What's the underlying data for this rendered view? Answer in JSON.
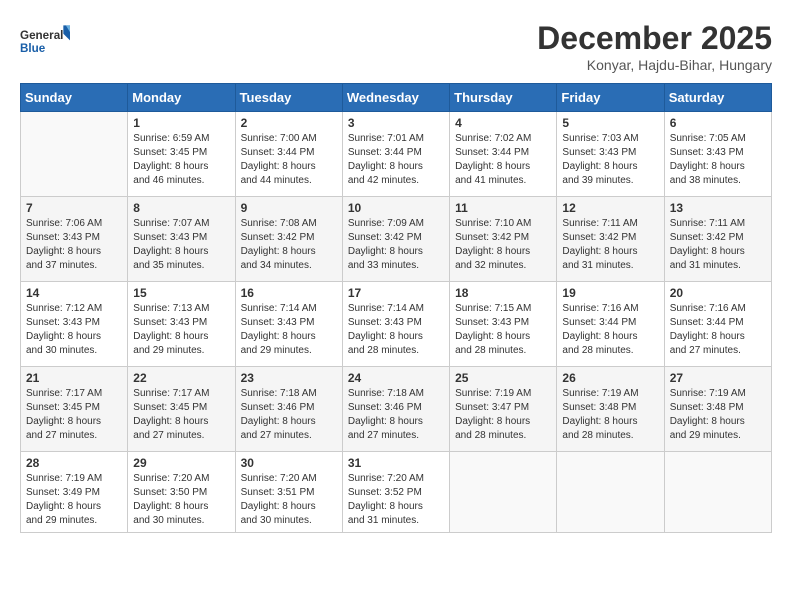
{
  "logo": {
    "line1": "General",
    "line2": "Blue"
  },
  "title": "December 2025",
  "subtitle": "Konyar, Hajdu-Bihar, Hungary",
  "days_header": [
    "Sunday",
    "Monday",
    "Tuesday",
    "Wednesday",
    "Thursday",
    "Friday",
    "Saturday"
  ],
  "weeks": [
    [
      {
        "day": "",
        "info": ""
      },
      {
        "day": "1",
        "info": "Sunrise: 6:59 AM\nSunset: 3:45 PM\nDaylight: 8 hours\nand 46 minutes."
      },
      {
        "day": "2",
        "info": "Sunrise: 7:00 AM\nSunset: 3:44 PM\nDaylight: 8 hours\nand 44 minutes."
      },
      {
        "day": "3",
        "info": "Sunrise: 7:01 AM\nSunset: 3:44 PM\nDaylight: 8 hours\nand 42 minutes."
      },
      {
        "day": "4",
        "info": "Sunrise: 7:02 AM\nSunset: 3:44 PM\nDaylight: 8 hours\nand 41 minutes."
      },
      {
        "day": "5",
        "info": "Sunrise: 7:03 AM\nSunset: 3:43 PM\nDaylight: 8 hours\nand 39 minutes."
      },
      {
        "day": "6",
        "info": "Sunrise: 7:05 AM\nSunset: 3:43 PM\nDaylight: 8 hours\nand 38 minutes."
      }
    ],
    [
      {
        "day": "7",
        "info": "Sunrise: 7:06 AM\nSunset: 3:43 PM\nDaylight: 8 hours\nand 37 minutes."
      },
      {
        "day": "8",
        "info": "Sunrise: 7:07 AM\nSunset: 3:43 PM\nDaylight: 8 hours\nand 35 minutes."
      },
      {
        "day": "9",
        "info": "Sunrise: 7:08 AM\nSunset: 3:42 PM\nDaylight: 8 hours\nand 34 minutes."
      },
      {
        "day": "10",
        "info": "Sunrise: 7:09 AM\nSunset: 3:42 PM\nDaylight: 8 hours\nand 33 minutes."
      },
      {
        "day": "11",
        "info": "Sunrise: 7:10 AM\nSunset: 3:42 PM\nDaylight: 8 hours\nand 32 minutes."
      },
      {
        "day": "12",
        "info": "Sunrise: 7:11 AM\nSunset: 3:42 PM\nDaylight: 8 hours\nand 31 minutes."
      },
      {
        "day": "13",
        "info": "Sunrise: 7:11 AM\nSunset: 3:42 PM\nDaylight: 8 hours\nand 31 minutes."
      }
    ],
    [
      {
        "day": "14",
        "info": "Sunrise: 7:12 AM\nSunset: 3:43 PM\nDaylight: 8 hours\nand 30 minutes."
      },
      {
        "day": "15",
        "info": "Sunrise: 7:13 AM\nSunset: 3:43 PM\nDaylight: 8 hours\nand 29 minutes."
      },
      {
        "day": "16",
        "info": "Sunrise: 7:14 AM\nSunset: 3:43 PM\nDaylight: 8 hours\nand 29 minutes."
      },
      {
        "day": "17",
        "info": "Sunrise: 7:14 AM\nSunset: 3:43 PM\nDaylight: 8 hours\nand 28 minutes."
      },
      {
        "day": "18",
        "info": "Sunrise: 7:15 AM\nSunset: 3:43 PM\nDaylight: 8 hours\nand 28 minutes."
      },
      {
        "day": "19",
        "info": "Sunrise: 7:16 AM\nSunset: 3:44 PM\nDaylight: 8 hours\nand 28 minutes."
      },
      {
        "day": "20",
        "info": "Sunrise: 7:16 AM\nSunset: 3:44 PM\nDaylight: 8 hours\nand 27 minutes."
      }
    ],
    [
      {
        "day": "21",
        "info": "Sunrise: 7:17 AM\nSunset: 3:45 PM\nDaylight: 8 hours\nand 27 minutes."
      },
      {
        "day": "22",
        "info": "Sunrise: 7:17 AM\nSunset: 3:45 PM\nDaylight: 8 hours\nand 27 minutes."
      },
      {
        "day": "23",
        "info": "Sunrise: 7:18 AM\nSunset: 3:46 PM\nDaylight: 8 hours\nand 27 minutes."
      },
      {
        "day": "24",
        "info": "Sunrise: 7:18 AM\nSunset: 3:46 PM\nDaylight: 8 hours\nand 27 minutes."
      },
      {
        "day": "25",
        "info": "Sunrise: 7:19 AM\nSunset: 3:47 PM\nDaylight: 8 hours\nand 28 minutes."
      },
      {
        "day": "26",
        "info": "Sunrise: 7:19 AM\nSunset: 3:48 PM\nDaylight: 8 hours\nand 28 minutes."
      },
      {
        "day": "27",
        "info": "Sunrise: 7:19 AM\nSunset: 3:48 PM\nDaylight: 8 hours\nand 29 minutes."
      }
    ],
    [
      {
        "day": "28",
        "info": "Sunrise: 7:19 AM\nSunset: 3:49 PM\nDaylight: 8 hours\nand 29 minutes."
      },
      {
        "day": "29",
        "info": "Sunrise: 7:20 AM\nSunset: 3:50 PM\nDaylight: 8 hours\nand 30 minutes."
      },
      {
        "day": "30",
        "info": "Sunrise: 7:20 AM\nSunset: 3:51 PM\nDaylight: 8 hours\nand 30 minutes."
      },
      {
        "day": "31",
        "info": "Sunrise: 7:20 AM\nSunset: 3:52 PM\nDaylight: 8 hours\nand 31 minutes."
      },
      {
        "day": "",
        "info": ""
      },
      {
        "day": "",
        "info": ""
      },
      {
        "day": "",
        "info": ""
      }
    ]
  ]
}
